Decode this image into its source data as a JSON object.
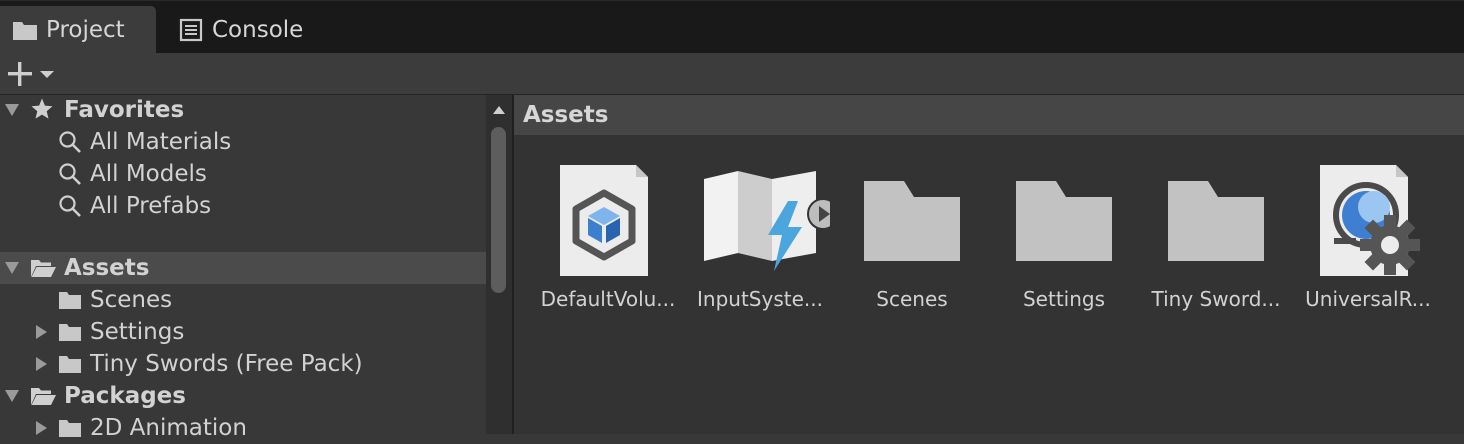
{
  "tabs": {
    "project": "Project",
    "console": "Console"
  },
  "toolbar": {
    "add_icon": "plus-icon",
    "add_dropdown_icon": "caret-down-icon"
  },
  "tree": {
    "favorites": {
      "label": "Favorites",
      "items": [
        "All Materials",
        "All Models",
        "All Prefabs"
      ]
    },
    "assets": {
      "label": "Assets",
      "children": [
        "Scenes",
        "Settings",
        "Tiny Swords (Free Pack)"
      ]
    },
    "packages": {
      "label": "Packages",
      "children": [
        "2D Animation"
      ]
    }
  },
  "breadcrumb": {
    "label": "Assets"
  },
  "assets_grid": [
    {
      "name": "DefaultVolu...",
      "icon": "volume-profile-icon"
    },
    {
      "name": "InputSyste...",
      "icon": "input-actions-icon"
    },
    {
      "name": "Scenes",
      "icon": "folder-icon"
    },
    {
      "name": "Settings",
      "icon": "folder-icon"
    },
    {
      "name": "Tiny Sword...",
      "icon": "folder-icon"
    },
    {
      "name": "UniversalR...",
      "icon": "render-pipeline-asset-icon"
    }
  ],
  "colors": {
    "background": "#383838",
    "tabbar": "#191919",
    "selected_row": "#4b4b4b",
    "folder": "#c2c2c2",
    "accent_blue": "#4a8fd9"
  }
}
